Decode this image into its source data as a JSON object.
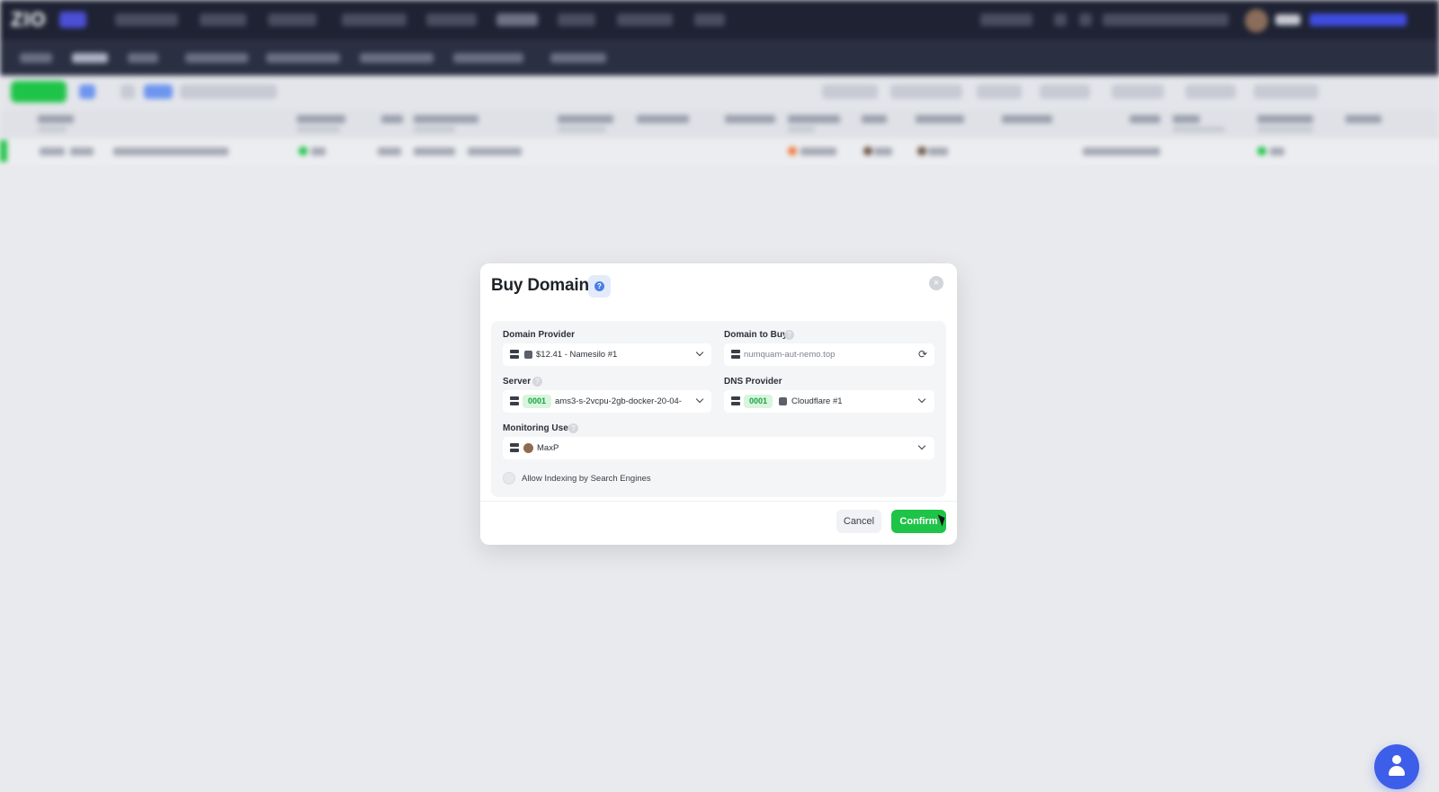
{
  "modal": {
    "title": "Buy Domain",
    "help_icon": "question-icon",
    "close_icon": "close-icon"
  },
  "form": {
    "domain_provider": {
      "label": "Domain Provider",
      "value": "$12.41 - Namesilo #1",
      "icon": "server-icon"
    },
    "domain_to_buy": {
      "label": "Domain to Buy",
      "placeholder": "numquam-aut-nemo.top",
      "icon": "server-icon",
      "action_icon": "refresh-icon"
    },
    "server": {
      "label": "Server",
      "tag": "0001",
      "value": "ams3-s-2vcpu-2gb-docker-20-04-"
    },
    "dns_provider": {
      "label": "DNS Provider",
      "tag": "0001",
      "value": "Cloudflare #1"
    },
    "monitoring_user": {
      "label": "Monitoring User",
      "value": "MaxP"
    },
    "allow_indexing": {
      "label": "Allow Indexing by Search Engines",
      "checked": false
    }
  },
  "footer": {
    "cancel_label": "Cancel",
    "confirm_label": "Confirm"
  },
  "colors": {
    "confirm": "#1ec447",
    "tag_bg": "#d8f5de",
    "tag_text": "#17a53d",
    "help_icon": "#4d7ee8",
    "fab": "#3d5ee8"
  },
  "floating": {
    "support_icon": "user-support-icon"
  }
}
